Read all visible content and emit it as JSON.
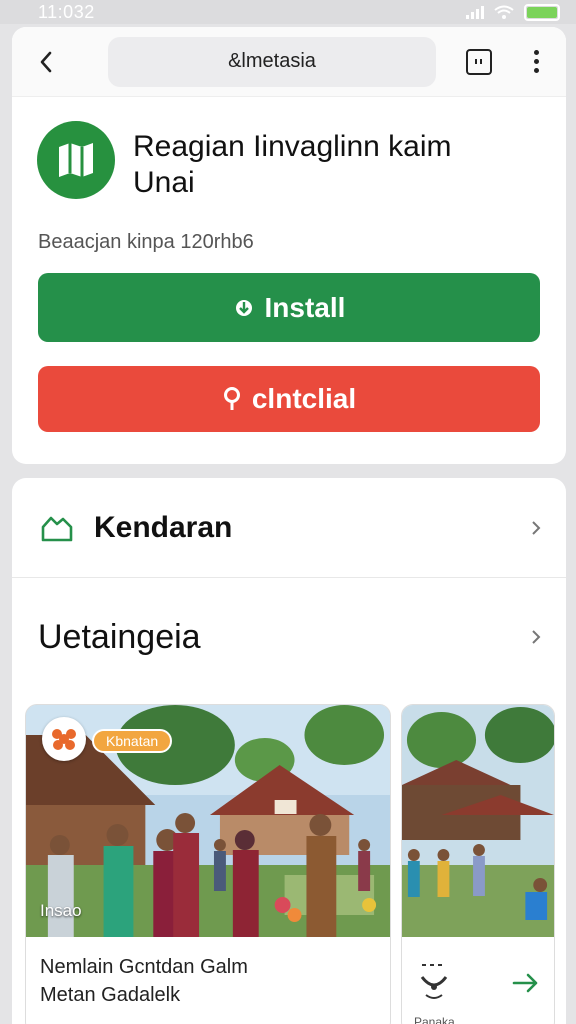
{
  "status_bar": {
    "time": "11:032"
  },
  "browser": {
    "url_text": "&lmetasia"
  },
  "app": {
    "title_line1": "Reagian Iinvaglinn kaim",
    "title_line2": "Unai",
    "meta": "Beaacjan kinpa 120rhb6",
    "install_label": "Install",
    "secondary_label": "clntclial"
  },
  "rows": {
    "kendaraan": "Kendaran",
    "section_title": "Uetaingeia"
  },
  "gallery": {
    "tile1": {
      "chip": "Kbnatan",
      "tag": "Insao",
      "caption_line1": "Nemlain Gcntdan Galm",
      "caption_line2": "Metan Gadalelk"
    },
    "tile2": {
      "footer_text": "Panaka"
    }
  },
  "colors": {
    "install": "#25904a",
    "secondary": "#ea4a3c",
    "app_icon": "#27913f",
    "battery": "#7bd35a"
  },
  "icons": {
    "back": "chevron-left-icon",
    "tabs": "tabs-icon",
    "more": "more-vertical-icon",
    "app": "book-map-icon",
    "kendaraan": "car-outline-icon",
    "chevron": "chevron-right-icon",
    "arrow": "arrow-right-icon"
  }
}
